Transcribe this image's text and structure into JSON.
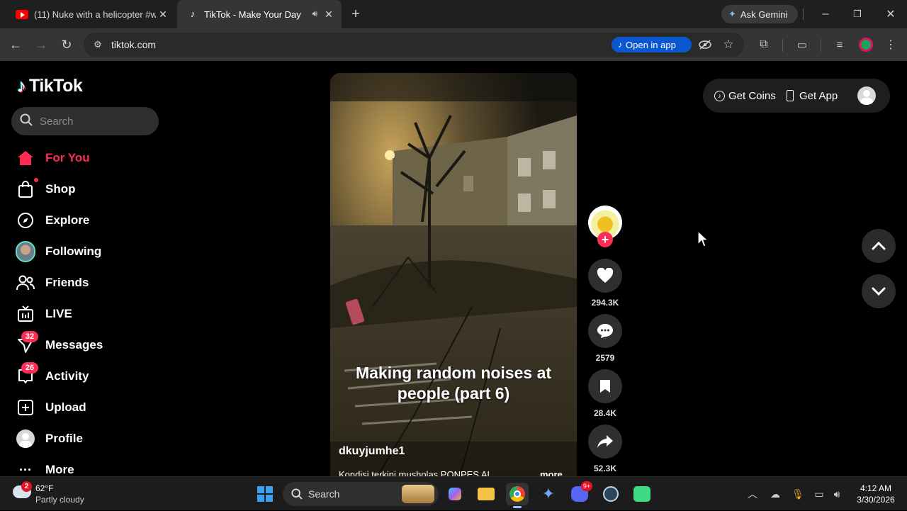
{
  "browser": {
    "tabs": [
      {
        "label": "(11) Nuke with a helicopter #wa",
        "icon": "youtube-icon",
        "active": false
      },
      {
        "label": "TikTok - Make Your Day",
        "icon": "tiktok-icon",
        "active": true
      }
    ],
    "url": "tiktok.com",
    "open_in_app": "Open in app",
    "ask_gemini": "Ask Gemini"
  },
  "sidebar": {
    "logo_text": "TikTok",
    "search_placeholder": "Search",
    "items": [
      {
        "label": "For You",
        "icon": "home-icon",
        "active": true
      },
      {
        "label": "Shop",
        "icon": "shopping-bag-icon"
      },
      {
        "label": "Explore",
        "icon": "compass-icon"
      },
      {
        "label": "Following",
        "icon": "following-avatar-icon"
      },
      {
        "label": "Friends",
        "icon": "friends-icon"
      },
      {
        "label": "LIVE",
        "icon": "live-tv-icon"
      },
      {
        "label": "Messages",
        "icon": "send-icon",
        "badge": "32"
      },
      {
        "label": "Activity",
        "icon": "activity-icon",
        "badge": "26"
      },
      {
        "label": "Upload",
        "icon": "plus-square-icon"
      },
      {
        "label": "Profile",
        "icon": "profile-avatar-icon"
      },
      {
        "label": "More",
        "icon": "more-dots-icon"
      }
    ]
  },
  "video": {
    "caption": "Making random noises at people (part 6)",
    "author": "dkuyjumhe1",
    "description": "Kondisi terkini musholas PONPES AL",
    "more_label": "more"
  },
  "actions": {
    "likes": "294.3K",
    "comments": "2579",
    "saves": "28.4K",
    "shares": "52.3K"
  },
  "topbar": {
    "get_coins": "Get Coins",
    "get_app": "Get App"
  },
  "taskbar": {
    "weather_badge": "2",
    "weather_temp": "62°F",
    "weather_desc": "Partly cloudy",
    "search_placeholder": "Search",
    "discord_badge": "9+",
    "time": "4:12 AM",
    "date": "3/30/2026"
  },
  "colors": {
    "accent": "#fe2c55",
    "background": "#000000",
    "chrome_blue": "#0b57d0"
  }
}
